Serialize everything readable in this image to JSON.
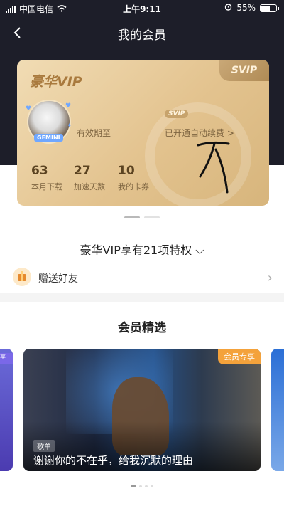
{
  "status_bar": {
    "carrier": "中国电信",
    "time": "上午9:11",
    "battery": "55%"
  },
  "nav": {
    "title": "我的会员"
  },
  "vip_card": {
    "title": "豪华VIP",
    "corner_badge": "SVIP",
    "avatar_tag": "GEMINI",
    "expire_label": "有效期至",
    "svip_small": "SVIP",
    "auto_renew": "已开通自动续费 >",
    "stats": [
      {
        "value": "63",
        "label": "本月下载"
      },
      {
        "value": "27",
        "label": "加速天数"
      },
      {
        "value": "10",
        "label": "我的卡券"
      }
    ],
    "accent_color": "#e3c38f"
  },
  "privileges": {
    "label": "豪华VIP享有21项特权 ⌵"
  },
  "gift": {
    "label": "赠送好友"
  },
  "picks": {
    "title": "会员精选",
    "left_side_tag": "享",
    "card": {
      "badge": "会员专享",
      "tag": "歌单",
      "title": "谢谢你的不在乎，给我沉默的理由"
    }
  }
}
